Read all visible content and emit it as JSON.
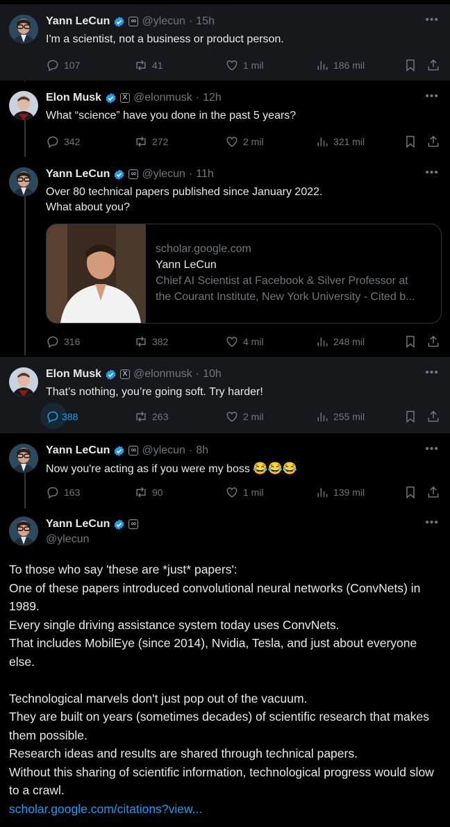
{
  "tweets": [
    {
      "name": "Yann LeCun",
      "handle": "@ylecun",
      "time": "15h",
      "affiliation": "∞",
      "text": "I'm a scientist, not a business or product person.",
      "replies": "107",
      "reposts": "41",
      "likes": "1 mil",
      "views": "186 mil",
      "avatar": "lecun"
    },
    {
      "name": "Elon Musk",
      "handle": "@elonmusk",
      "time": "12h",
      "affiliation": "X",
      "text": "What “science” have you done in the past 5 years?",
      "replies": "342",
      "reposts": "272",
      "likes": "2 mil",
      "views": "321 mil",
      "avatar": "musk"
    },
    {
      "name": "Yann LeCun",
      "handle": "@ylecun",
      "time": "11h",
      "affiliation": "∞",
      "text_lines": [
        "Over 80 technical papers published since January 2022.",
        "What about you?"
      ],
      "replies": "316",
      "reposts": "382",
      "likes": "4 mil",
      "views": "248 mil",
      "avatar": "lecun"
    },
    {
      "name": "Elon Musk",
      "handle": "@elonmusk",
      "time": "10h",
      "affiliation": "X",
      "text": "That’s nothing, you’re going soft. Try harder!",
      "replies": "388",
      "reposts": "263",
      "likes": "2 mil",
      "views": "255 mil",
      "avatar": "musk"
    },
    {
      "name": "Yann LeCun",
      "handle": "@ylecun",
      "time": "8h",
      "affiliation": "∞",
      "text": "Now you're acting as if you were my boss",
      "emoji": "😂😂😂",
      "replies": "163",
      "reposts": "90",
      "likes": "1 mil",
      "views": "139 mil",
      "avatar": "lecun"
    }
  ],
  "card": {
    "domain": "scholar.google.com",
    "title": "Yann LeCun",
    "desc_line1": "Chief AI Scientist at Facebook & Silver Professor at",
    "desc_line2": "the Courant Institute, New York University - Cited b..."
  },
  "main": {
    "name": "Yann LeCun",
    "handle": "@ylecun",
    "affiliation": "∞",
    "paragraphs": [
      "To those who say 'these are *just* papers':",
      "One of these papers introduced convolutional neural networks (ConvNets) in 1989.",
      "Every single driving assistance system today uses ConvNets.",
      "That includes MobilEye (since 2014), Nvidia, Tesla, and just about everyone else.",
      "",
      "Technological marvels don't just pop out of the vacuum.",
      "They are built on years (sometimes decades) of scientific research that makes them possible.",
      "Research ideas and results are shared through technical papers.",
      "Without this sharing of scientific information, technological progress would slow to a crawl."
    ],
    "link": "scholar.google.com/citations?view..."
  },
  "icons": {
    "more": "more-icon",
    "reply": "reply-icon",
    "repost": "repost-icon",
    "like": "like-icon",
    "views": "views-icon",
    "bookmark": "bookmark-icon",
    "share": "share-icon"
  },
  "colors": {
    "background": "#000000",
    "highlight": "#16181c",
    "accent": "#1d9bf0",
    "muted": "#71767b",
    "verified": "#1d9bf0"
  }
}
